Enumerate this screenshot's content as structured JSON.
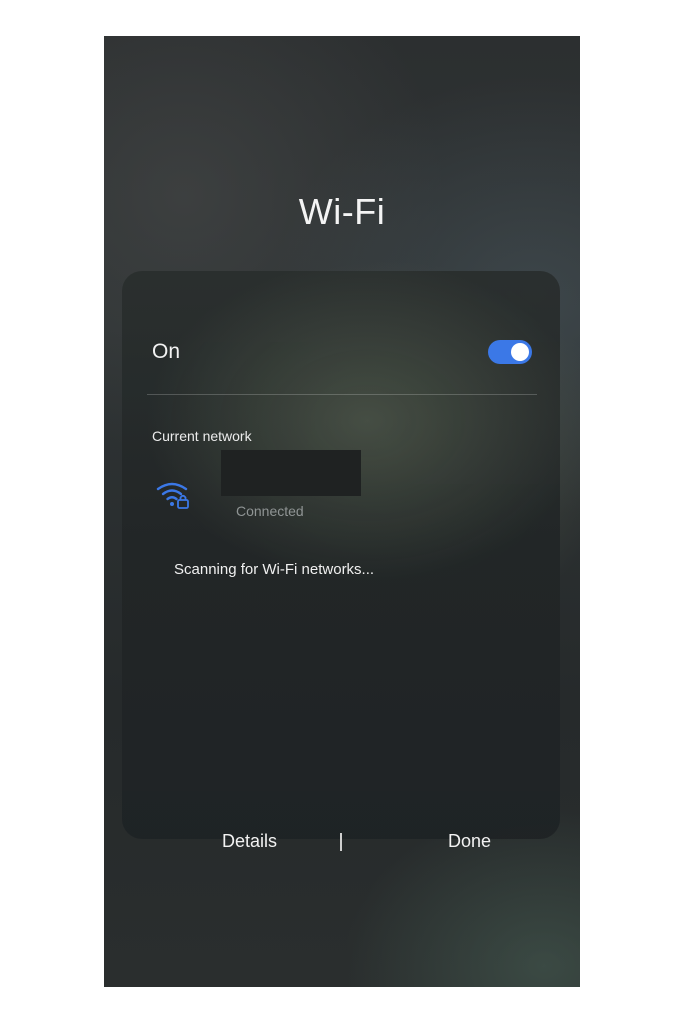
{
  "header": {
    "title": "Wi-Fi"
  },
  "wifi_panel": {
    "toggle_label": "On",
    "toggle_state": true,
    "toggle_color": "#3b78e7",
    "current_network": {
      "section_label": "Current network",
      "name": "",
      "status": "Connected",
      "icon": "wifi-locked-icon",
      "icon_color": "#3b78e7"
    },
    "scanning_text": "Scanning for Wi-Fi networks...",
    "buttons": {
      "details": "Details",
      "done": "Done"
    }
  }
}
